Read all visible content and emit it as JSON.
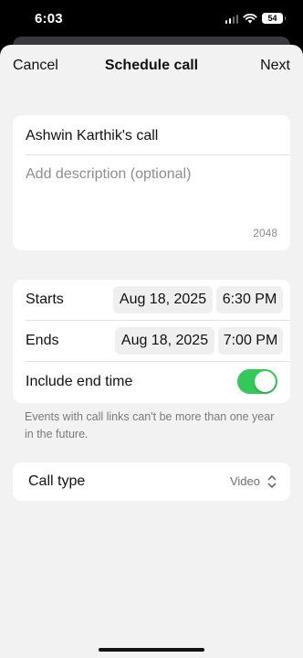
{
  "status_bar": {
    "time": "6:03",
    "battery": "54"
  },
  "nav": {
    "cancel_label": "Cancel",
    "title": "Schedule call",
    "next_label": "Next"
  },
  "details": {
    "title_value": "Ashwin Karthik's call",
    "description_placeholder": "Add description (optional)",
    "char_limit": "2048"
  },
  "schedule": {
    "starts_label": "Starts",
    "start_date": "Aug 18, 2025",
    "start_time": "6:30 PM",
    "ends_label": "Ends",
    "end_date": "Aug 18, 2025",
    "end_time": "7:00 PM",
    "include_end_label": "Include end time",
    "include_end_on": true,
    "toggle_color": "#34c759"
  },
  "note": "Events with call links can't be more than one year in the future.",
  "call_type": {
    "label": "Call type",
    "value": "Video"
  }
}
